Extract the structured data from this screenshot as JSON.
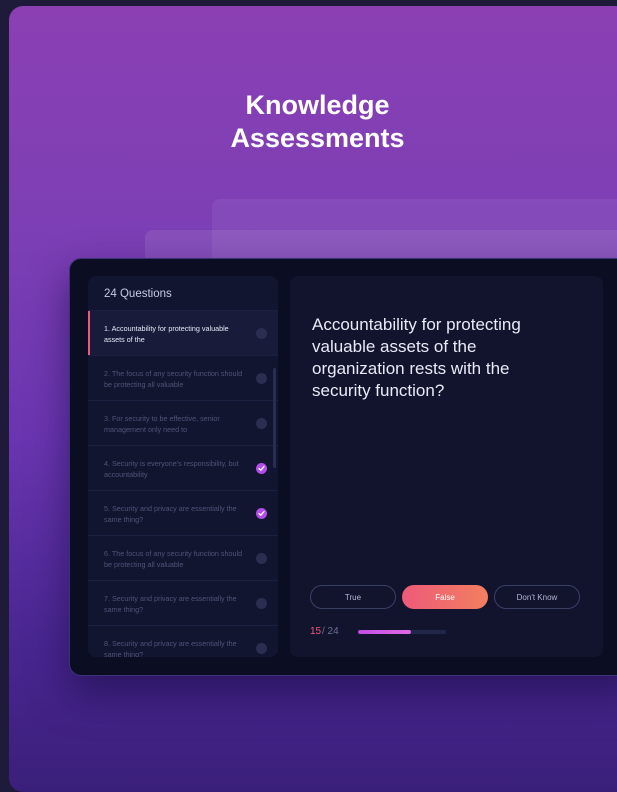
{
  "hero": {
    "title_line1": "Knowledge",
    "title_line2": "Assessments"
  },
  "sidebar": {
    "title": "24 Questions",
    "items": [
      {
        "label": "1.  Accountability for protecting valuable assets of the",
        "state": "active"
      },
      {
        "label": "2.  The focus of any security function should be protecting all valuable",
        "state": "pending"
      },
      {
        "label": "3.  For security to be effective, senior management only need to",
        "state": "pending"
      },
      {
        "label": "4.  Security is everyone's responsibility, but accountability",
        "state": "done"
      },
      {
        "label": "5.  Security and privacy are essentially the same thing?",
        "state": "done"
      },
      {
        "label": "6.  The focus of any security function should be protecting all valuable",
        "state": "pending"
      },
      {
        "label": "7.  Security and privacy are essentially the same thing?",
        "state": "pending"
      },
      {
        "label": "8.  Security and privacy are essentially the same thing?",
        "state": "pending"
      }
    ]
  },
  "question": {
    "text": "Accountability for protecting valuable assets of the organization rests with the security function?"
  },
  "answers": {
    "true_label": "True",
    "false_label": "False",
    "dont_know_label": "Don't Know",
    "selected": "False"
  },
  "progress": {
    "current": "15",
    "total_text": "/ 24",
    "fraction": 0.6
  },
  "colors": {
    "accent": "#ee5a79",
    "done_check": "#b14de8",
    "bg_top": "#8b3fb3",
    "bg_bottom": "#3a1f7a"
  }
}
